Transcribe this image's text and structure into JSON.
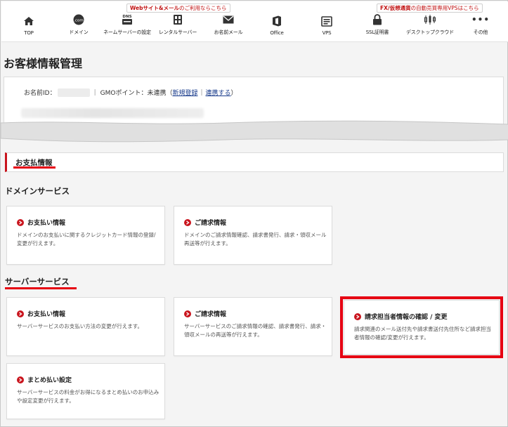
{
  "nav": {
    "promos": [
      {
        "bold": "Webサイト&メール",
        "rest": "のご利用ならこちら"
      },
      {
        "bold": "FX/仮想通貨",
        "rest": "の自動売買専用VPSはこちら"
      }
    ],
    "items": [
      {
        "label": "TOP",
        "icon": "home-icon"
      },
      {
        "label": "ドメイン",
        "icon": "domain-icon",
        "icon_text": ".com"
      },
      {
        "label": "ネームサーバーの設定",
        "icon": "dns-icon",
        "icon_text": "DNS"
      },
      {
        "label": "レンタルサーバー",
        "icon": "server-icon"
      },
      {
        "label": "お名前メール",
        "icon": "mail-icon"
      },
      {
        "label": "Office",
        "icon": "office-icon"
      },
      {
        "label": "VPS",
        "icon": "vps-icon"
      },
      {
        "label": "SSL証明書",
        "icon": "lock-icon"
      },
      {
        "label": "デスクトップクラウド",
        "icon": "chart-icon"
      },
      {
        "label": "その他",
        "icon": "more-icon",
        "icon_text": "•••"
      }
    ]
  },
  "page": {
    "title": "お客様情報管理",
    "id_label": "お名前ID：",
    "gmo_label": "GMOポイント：未連携（",
    "new_register": "新規登録",
    "link": "連携する",
    "close_paren": "）",
    "bar": "|"
  },
  "payment": {
    "section_title": "お支払情報",
    "domain_heading": "ドメインサービス",
    "server_heading": "サーバーサービス",
    "domain_cards": [
      {
        "title": "お支払い情報",
        "desc": "ドメインのお支払いに関するクレジットカード情報の登録/変更が行えます。"
      },
      {
        "title": "ご請求情報",
        "desc": "ドメインのご請求情報確認、請求書発行、請求・領収メール再送等が行えます。"
      }
    ],
    "server_cards": [
      {
        "title": "お支払い情報",
        "desc": "サーバーサービスのお支払い方法の変更が行えます。"
      },
      {
        "title": "ご請求情報",
        "desc": "サーバーサービスのご請求情報の確認、請求書発行、請求・領収メールの再送等が行えます。"
      },
      {
        "title": "請求担当者情報の確認 / 変更",
        "desc": "請求関連のメール送付先や請求書送付先住所など請求担当者情報の確認/変更が行えます。"
      },
      {
        "title": "まとめ払い設定",
        "desc": "サーバーサービスの料金がお得になるまとめ払いのお申込みや設定変更が行えます。"
      }
    ]
  },
  "colors": {
    "accent": "#e60012",
    "brand_red": "#c9141d"
  }
}
